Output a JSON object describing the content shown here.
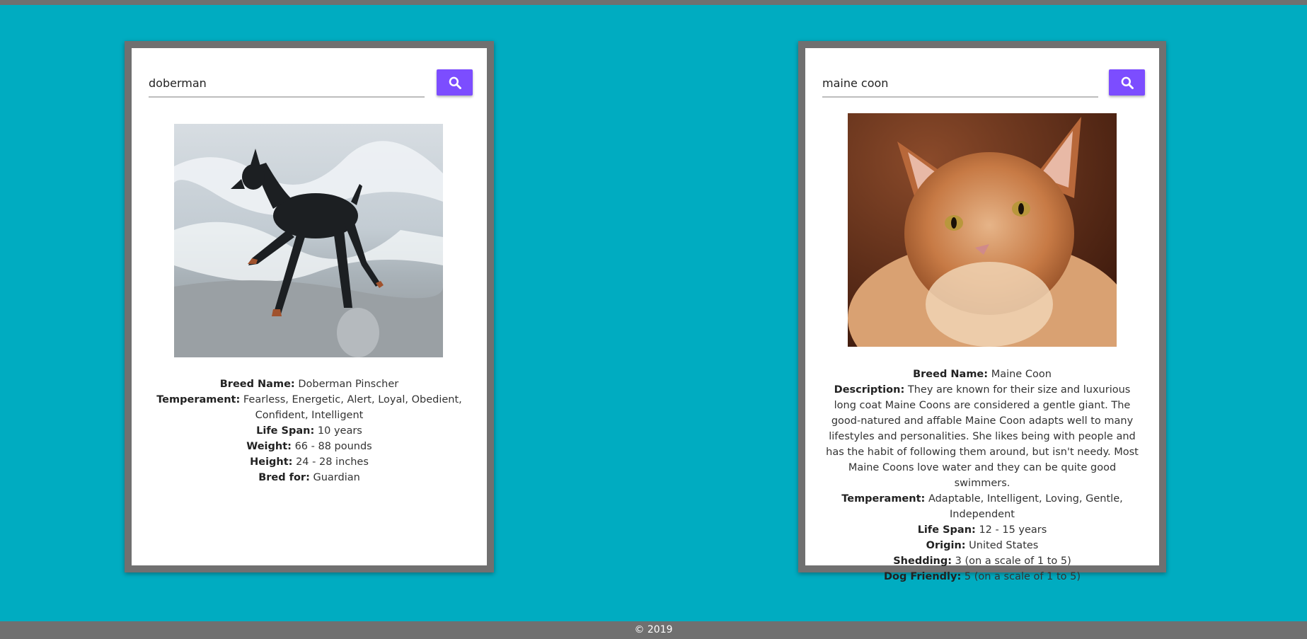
{
  "dog_card": {
    "search_value": "doberman",
    "image_alt": "Doberman running on beach",
    "fields": [
      {
        "label": "Breed Name:",
        "value": "Doberman Pinscher"
      },
      {
        "label": "Temperament:",
        "value": "Fearless, Energetic, Alert, Loyal, Obedient, Confident, Intelligent"
      },
      {
        "label": "Life Span:",
        "value": "10 years"
      },
      {
        "label": "Weight:",
        "value": "66 - 88 pounds"
      },
      {
        "label": "Height:",
        "value": "24 - 28 inches"
      },
      {
        "label": "Bred for:",
        "value": "Guardian"
      }
    ]
  },
  "cat_card": {
    "search_value": "maine coon",
    "image_alt": "Maine Coon cat",
    "fields": [
      {
        "label": "Breed Name:",
        "value": "Maine Coon"
      },
      {
        "label": "Description:",
        "value": "They are known for their size and luxurious long coat Maine Coons are considered a gentle giant. The good-natured and affable Maine Coon adapts well to many lifestyles and personalities. She likes being with people and has the habit of following them around, but isn't needy. Most Maine Coons love water and they can be quite good swimmers."
      },
      {
        "label": "Temperament:",
        "value": "Adaptable, Intelligent, Loving, Gentle, Independent"
      },
      {
        "label": "Life Span:",
        "value": "12 - 15 years"
      },
      {
        "label": "Origin:",
        "value": "United States"
      },
      {
        "label": "Shedding:",
        "value": "3 (on a scale of 1 to 5)"
      },
      {
        "label": "Dog Friendly:",
        "value": "5 (on a scale of 1 to 5)"
      }
    ]
  },
  "footer": {
    "text": "© 2019"
  },
  "colors": {
    "background": "#00acc1",
    "bar": "#707070",
    "accent": "#7c4dff"
  },
  "icons": {
    "search": "search-icon"
  }
}
